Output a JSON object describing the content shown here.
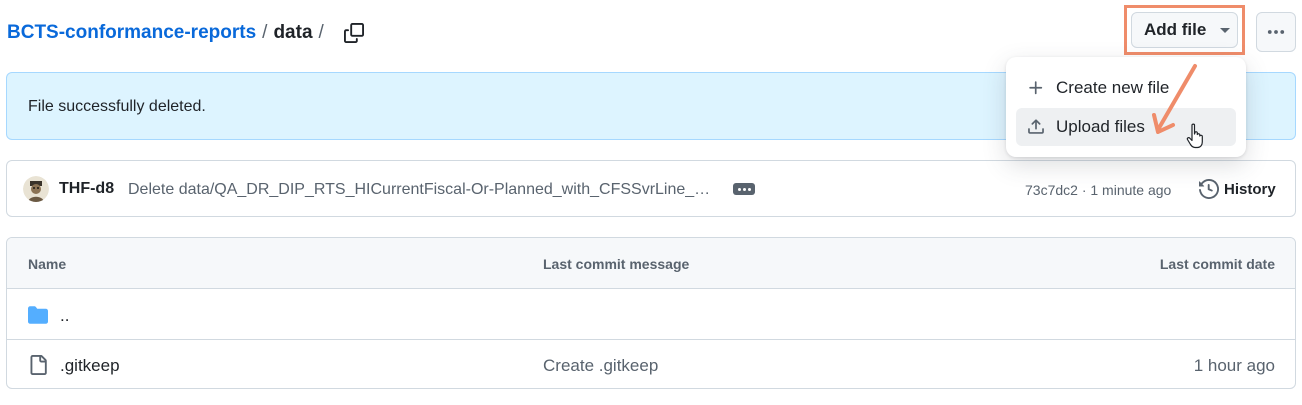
{
  "breadcrumb": {
    "repo": "BCTS-conformance-reports",
    "separator": "/",
    "dir": "data",
    "trailing_separator": "/"
  },
  "toolbar": {
    "add_file_label": "Add file",
    "more_icon": "kebab-horizontal-icon"
  },
  "flash": {
    "message": "File successfully deleted."
  },
  "dropdown": {
    "items": [
      {
        "label": "Create new file",
        "icon": "plus-icon"
      },
      {
        "label": "Upload files",
        "icon": "upload-icon"
      }
    ]
  },
  "commit": {
    "author": "THF-d8",
    "message": "Delete data/QA_DR_DIP_RTS_HICurrentFiscal-Or-Planned_with_CFSSvrLine_…",
    "meta": "73c7dc2 · 1 minute ago",
    "history_label": "History"
  },
  "table": {
    "headers": {
      "name": "Name",
      "message": "Last commit message",
      "date": "Last commit date"
    },
    "rows": [
      {
        "name": "..",
        "icon": "folder-icon",
        "message": "",
        "date": ""
      },
      {
        "name": ".gitkeep",
        "icon": "file-icon",
        "message": "Create .gitkeep",
        "date": "1 hour ago"
      }
    ]
  },
  "colors": {
    "link": "#0969da",
    "flash_bg": "#ddf4ff",
    "annotation": "#ef8c6a",
    "folder": "#54aeff"
  }
}
